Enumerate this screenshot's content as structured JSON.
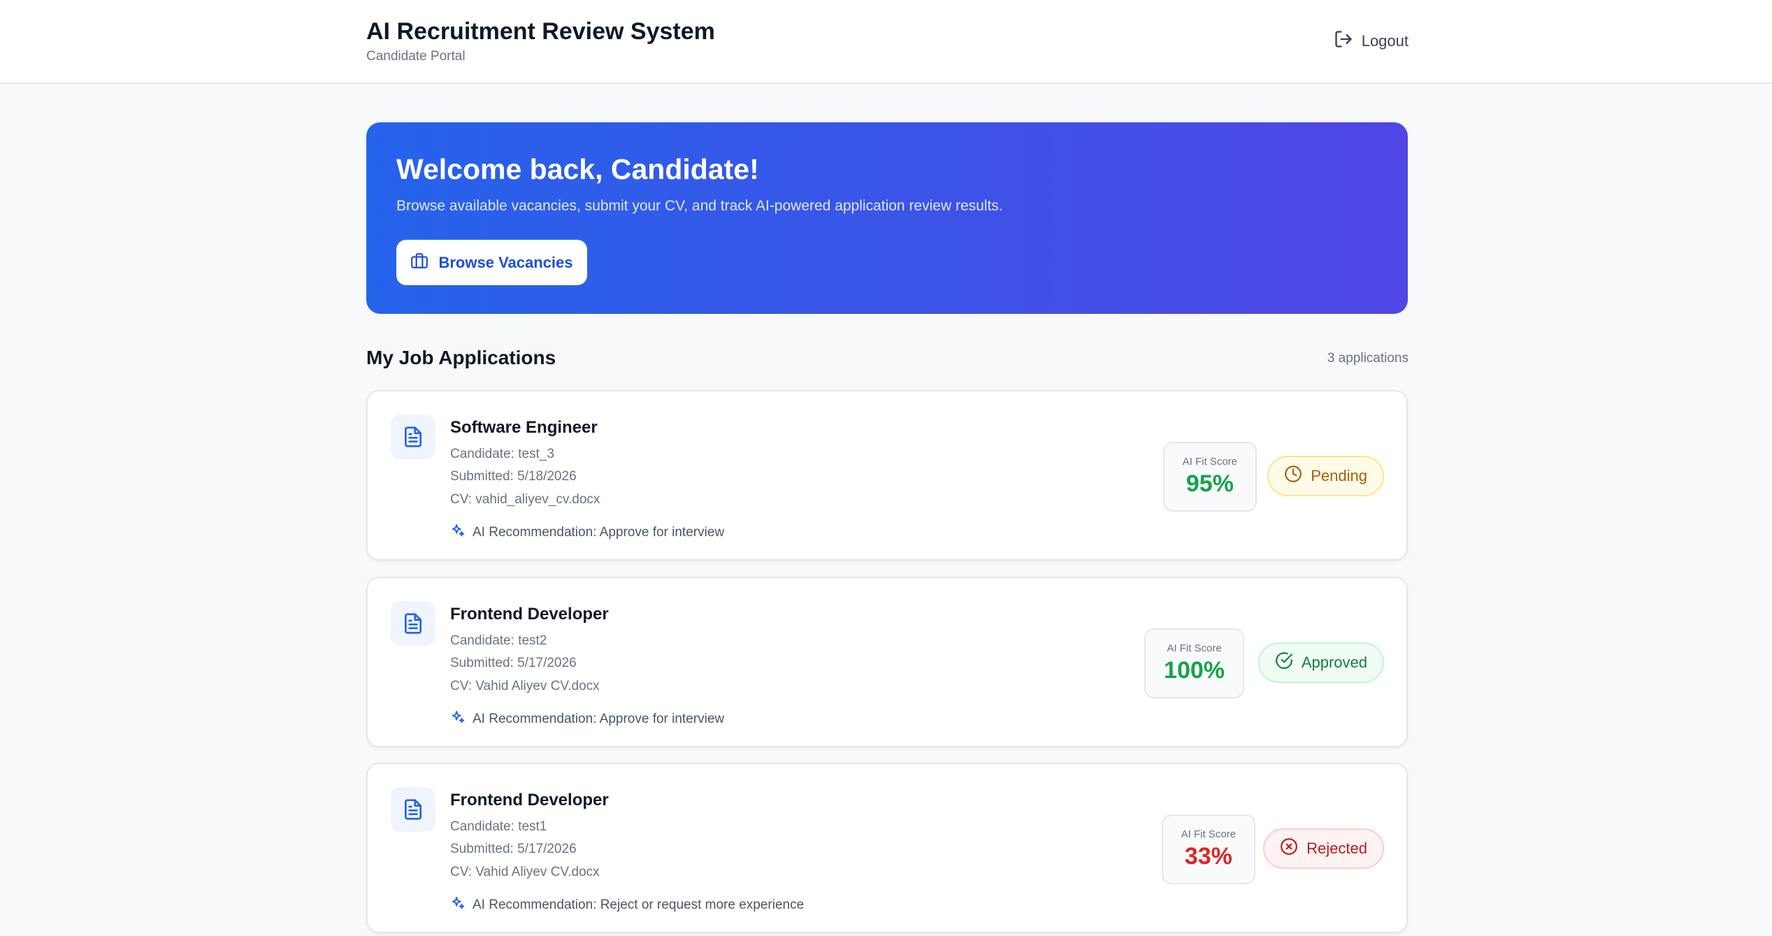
{
  "header": {
    "title": "AI Recruitment Review System",
    "subtitle": "Candidate Portal",
    "logout_label": "Logout"
  },
  "hero": {
    "title": "Welcome back, Candidate!",
    "text": "Browse available vacancies, submit your CV, and track AI-powered application review results.",
    "button_label": "Browse Vacancies"
  },
  "applications_section": {
    "title": "My Job Applications",
    "count": "3 applications"
  },
  "applications": [
    {
      "title": "Software Engineer",
      "candidate": "Candidate: test_3",
      "submitted": "Submitted: 5/18/2026",
      "cv": "CV: vahid_aliyev_cv.docx",
      "recommendation": "AI Recommendation: Approve for interview",
      "score_label": "AI Fit Score",
      "score": "95%",
      "score_color": "#16a34a",
      "status": "Pending",
      "status_icon": "clock-icon",
      "status_text_color": "#a16207",
      "status_bg": "#fefce8",
      "status_border": "#fde68a"
    },
    {
      "title": "Frontend Developer",
      "candidate": "Candidate: test2",
      "submitted": "Submitted: 5/17/2026",
      "cv": "CV: Vahid Aliyev CV.docx",
      "recommendation": "AI Recommendation: Approve for interview",
      "score_label": "AI Fit Score",
      "score": "100%",
      "score_color": "#16a34a",
      "status": "Approved",
      "status_icon": "check-circle-icon",
      "status_text_color": "#15803d",
      "status_bg": "#f0fdf4",
      "status_border": "#bbf7d0"
    },
    {
      "title": "Frontend Developer",
      "candidate": "Candidate: test1",
      "submitted": "Submitted: 5/17/2026",
      "cv": "CV: Vahid Aliyev CV.docx",
      "recommendation": "AI Recommendation: Reject or request more experience",
      "score_label": "AI Fit Score",
      "score": "33%",
      "score_color": "#dc2626",
      "status": "Rejected",
      "status_icon": "x-circle-icon",
      "status_text_color": "#b91c1c",
      "status_bg": "#fef2f2",
      "status_border": "#fecaca"
    }
  ]
}
